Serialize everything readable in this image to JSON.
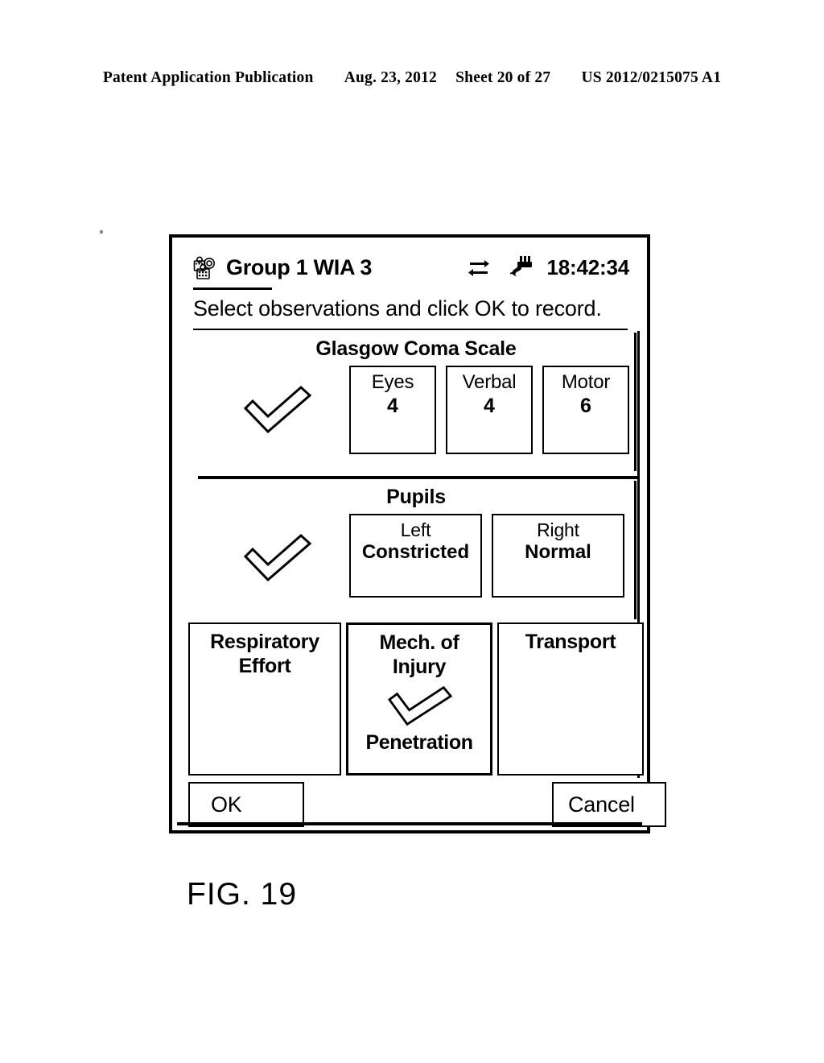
{
  "patent_header": {
    "publication": "Patent Application Publication",
    "date": "Aug. 23, 2012",
    "sheet": "Sheet 20 of 27",
    "number": "US 2012/0215075 A1"
  },
  "figure": {
    "caption": "FIG. 19"
  },
  "device": {
    "titlebar": {
      "group_icon": "group-people-icon",
      "title": "Group 1 WIA 3",
      "sync_icon": "sync-arrows-icon",
      "link_icon": "connector-plug-icon",
      "time": "18:42:34"
    },
    "instruction": "Select observations and click OK to record.",
    "sections": [
      {
        "id": "glasgow-coma-scale",
        "title": "Glasgow Coma Scale",
        "checked": true,
        "check_icon": "checkmark-icon",
        "items": [
          {
            "label": "Eyes",
            "value": "4"
          },
          {
            "label": "Verbal",
            "value": "4"
          },
          {
            "label": "Motor",
            "value": "6"
          }
        ]
      },
      {
        "id": "pupils",
        "title": "Pupils",
        "checked": true,
        "check_icon": "checkmark-icon",
        "items": [
          {
            "label": "Left",
            "value": "Constricted"
          },
          {
            "label": "Right",
            "value": "Normal"
          }
        ]
      }
    ],
    "observation_buttons": [
      {
        "id": "respiratory-effort",
        "title": "Respiratory\nEffort",
        "line1": "Respiratory",
        "line2": "Effort",
        "value": "",
        "checked": false
      },
      {
        "id": "mech-of-injury",
        "title": "Mech. of\nInjury",
        "line1": "Mech. of",
        "line2": "Injury",
        "value": "Penetration",
        "checked": true,
        "check_icon": "checkmark-icon"
      },
      {
        "id": "transport",
        "title": "Transport",
        "line1": "Transport",
        "line2": "",
        "value": "",
        "checked": false
      }
    ],
    "footer": {
      "ok_label": "OK",
      "cancel_label": "Cancel"
    }
  },
  "colors": {
    "ink": "#000000",
    "paper": "#ffffff"
  }
}
